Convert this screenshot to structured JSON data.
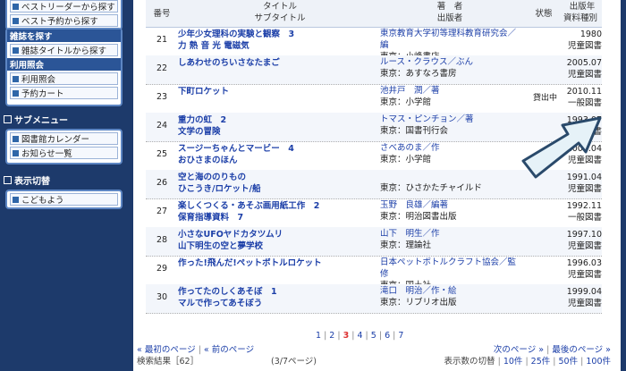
{
  "sidebar": {
    "top_items": [
      "ベストリーダーから探す",
      "ベスト予約から探す"
    ],
    "magazine_header": "雑誌を探す",
    "magazine_items": [
      "雑誌タイトルから探す"
    ],
    "usage_header": "利用照会",
    "usage_items": [
      "利用照会",
      "予約カート"
    ],
    "submenu_title": "サブメニュー",
    "submenu_items": [
      "図書館カレンダー",
      "お知らせ一覧"
    ],
    "display_title": "表示切替",
    "display_items": [
      "こどもよう"
    ]
  },
  "table": {
    "headers": {
      "no": "番号",
      "title": "タイトル",
      "subtitle": "サブタイトル",
      "author": "著　者",
      "publisher": "出版者",
      "status": "状態",
      "year": "出版年",
      "type": "資料種別"
    },
    "rows": [
      {
        "no": "21",
        "title": "少年少女理科の実験と観察　3",
        "title2": "力 熱 音 光 電磁気",
        "author": "東京教育大学初等理科教育研究会／",
        "author2": "編",
        "publisher": "東京：小峰書店",
        "status": "",
        "year": "1980",
        "type": "児童図書"
      },
      {
        "no": "22",
        "title": "しあわせのちいさなたまご",
        "title2": "",
        "author": "ルース・クラウス／ぶん",
        "author2": "",
        "publisher": "東京：あすなろ書房",
        "status": "",
        "year": "2005.07",
        "type": "児童図書"
      },
      {
        "no": "23",
        "title": "下町ロケット",
        "title2": "",
        "author": "池井戸　潤／著",
        "author2": "",
        "publisher": "東京：小学館",
        "status": "貸出中",
        "year": "2010.11",
        "type": "一般図書"
      },
      {
        "no": "24",
        "title": "重力の虹　2",
        "title2": "文学の冒険",
        "author": "トマス・ピンチョン／著",
        "author2": "",
        "publisher": "東京：国書刊行会",
        "status": "",
        "year": "1993.07",
        "type": "一般図書"
      },
      {
        "no": "25",
        "title": "スージーちゃんとマービー　4",
        "title2": "おひさまのほん",
        "author": "さべあのま／作",
        "author2": "",
        "publisher": "東京：小学館",
        "status": "",
        "year": "2000.04",
        "type": "児童図書"
      },
      {
        "no": "26",
        "title": "空と海ののりもの",
        "title2": "ひこうき/ロケット/船",
        "author": "",
        "author2": "",
        "publisher": "東京：ひさかたチャイルド",
        "status": "",
        "year": "1991.04",
        "type": "児童図書"
      },
      {
        "no": "27",
        "title": "楽しくつくる・あそぶ画用紙工作　2",
        "title2": "保育指導資料　7",
        "author": "玉野　良雄／編著",
        "author2": "",
        "publisher": "東京：明治図書出版",
        "status": "",
        "year": "1992.11",
        "type": "一般図書"
      },
      {
        "no": "28",
        "title": "小さなUFOヤドカタツムリ",
        "title2": "山下明生の空と夢学校",
        "author": "山下　明生／作",
        "author2": "",
        "publisher": "東京：理論社",
        "status": "",
        "year": "1997.10",
        "type": "児童図書"
      },
      {
        "no": "29",
        "title": "作った!飛んだ!ペットボトルロケット",
        "title2": "",
        "author": "日本ペットボトルクラフト協会／監",
        "author2": "修",
        "publisher": "東京：国土社",
        "status": "",
        "year": "1996.03",
        "type": "児童図書"
      },
      {
        "no": "30",
        "title": "作ってたのしくあそぼ　1",
        "title2": "マルで作ってあそぼう",
        "author": "滝口　明治／作・絵",
        "author2": "",
        "publisher": "東京：リブリオ出版",
        "status": "",
        "year": "1999.04",
        "type": "児童図書"
      }
    ]
  },
  "pager": {
    "pages": [
      "1",
      "2",
      "3",
      "4",
      "5",
      "6",
      "7"
    ],
    "current": "3",
    "first": "« 最初のページ",
    "prev": "« 前のページ",
    "next": "次のページ »",
    "last": "最後のページ »",
    "results": "検索結果［62］",
    "page_info": "(3/7ページ)",
    "per_page_label": "表示数の切替",
    "per_page": [
      "10件",
      "25件",
      "50件",
      "100件"
    ]
  }
}
